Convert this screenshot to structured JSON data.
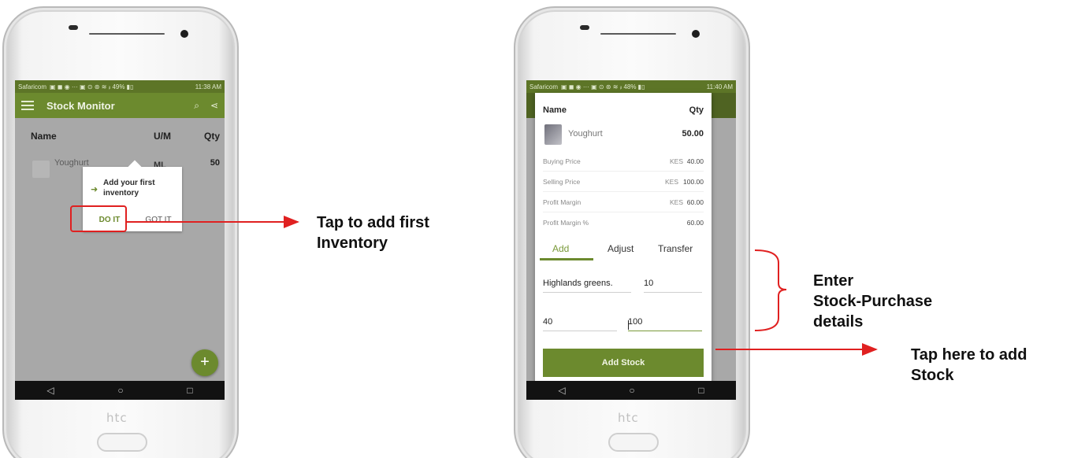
{
  "left_phone": {
    "brand": "htc",
    "status_bar": {
      "carrier": "Safaricom",
      "indicators": "▣ ◼ ◉ ··· ▣ ⊙ ⊛ ≋ ᵢₗ 49% ▮▯",
      "time": "11:38 AM"
    },
    "toolbar": {
      "title": "Stock Monitor",
      "search_icon": "⌕",
      "share_icon": "⋖"
    },
    "list": {
      "headers": {
        "name": "Name",
        "um": "U/M",
        "qty": "Qty"
      },
      "row": {
        "name": "Youghurt",
        "um": "ML",
        "qty": "50"
      }
    },
    "coach_mark": {
      "icon": "➜",
      "text": "Add your first inventory",
      "do_it": "DO IT",
      "got_it": "GOT IT"
    },
    "fab_label": "+",
    "nav": {
      "back": "◁",
      "home": "○",
      "recents": "□"
    }
  },
  "right_phone": {
    "brand": "htc",
    "status_bar": {
      "carrier": "Safaricom",
      "indicators": "▣ ◼ ◉ ··· ▣ ⊙ ⊛ ≋ ᵢₗ 48% ▮▯",
      "time": "11:40 AM"
    },
    "dialog": {
      "headers": {
        "name": "Name",
        "qty": "Qty"
      },
      "item": {
        "name": "Youghurt",
        "qty": "50.00"
      },
      "prices": [
        {
          "label": "Buying Price",
          "currency": "KES",
          "value": "40.00"
        },
        {
          "label": "Selling Price",
          "currency": "KES",
          "value": "100.00"
        },
        {
          "label": "Profit Margin",
          "currency": "KES",
          "value": "60.00"
        },
        {
          "label": "Profit Margin %",
          "currency": "",
          "value": "60.00"
        }
      ],
      "tabs": {
        "add": "Add",
        "adjust": "Adjust",
        "transfer": "Transfer"
      },
      "fields": {
        "supplier": "Highlands greens.",
        "quantity": "10",
        "buying_price": "40",
        "selling_price": "100"
      },
      "add_stock_label": "Add Stock"
    },
    "nav": {
      "back": "◁",
      "home": "○",
      "recents": "□"
    }
  },
  "annotations": {
    "first_inventory": [
      "Tap to add first",
      "Inventory"
    ],
    "purchase_details": [
      "Enter",
      "Stock-Purchase",
      "details"
    ],
    "add_stock": [
      "Tap here to add",
      "Stock"
    ]
  },
  "colors": {
    "primary_green": "#6c8a2e",
    "annotation_red": "#e02020"
  }
}
